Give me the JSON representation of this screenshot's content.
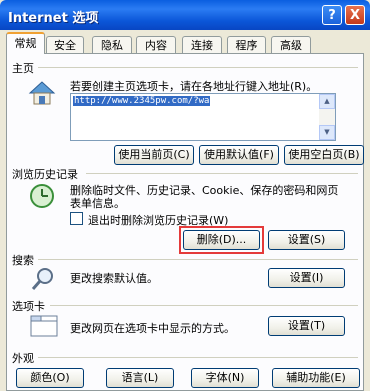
{
  "window": {
    "title": "Internet 选项",
    "help_label": "?",
    "close_label": "X"
  },
  "tabs": [
    "常规",
    "安全",
    "隐私",
    "内容",
    "连接",
    "程序",
    "高级"
  ],
  "home": {
    "section": "主页",
    "desc": "若要创建主页选项卡，请在各地址行键入地址(R)。",
    "url": "http://www.2345pw.com/?wa",
    "buttons": [
      "使用当前页(C)",
      "使用默认值(F)",
      "使用空白页(B)"
    ]
  },
  "history": {
    "section": "浏览历史记录",
    "desc1": "删除临时文件、历史记录、Cookie、保存的密码和网页",
    "desc2": "表单信息。",
    "checkbox": "退出时删除浏览历史记录(W)",
    "delete_button": "删除(D)...",
    "settings_button": "设置(S)"
  },
  "search": {
    "section": "搜索",
    "desc": "更改搜索默认值。",
    "settings_button": "设置(I)"
  },
  "tabs_section": {
    "section": "选项卡",
    "desc": "更改网页在选项卡中显示的方式。",
    "settings_button": "设置(T)"
  },
  "appearance": {
    "section": "外观",
    "buttons": [
      "颜色(O)",
      "语言(L)",
      "字体(N)",
      "辅助功能(E)"
    ]
  }
}
